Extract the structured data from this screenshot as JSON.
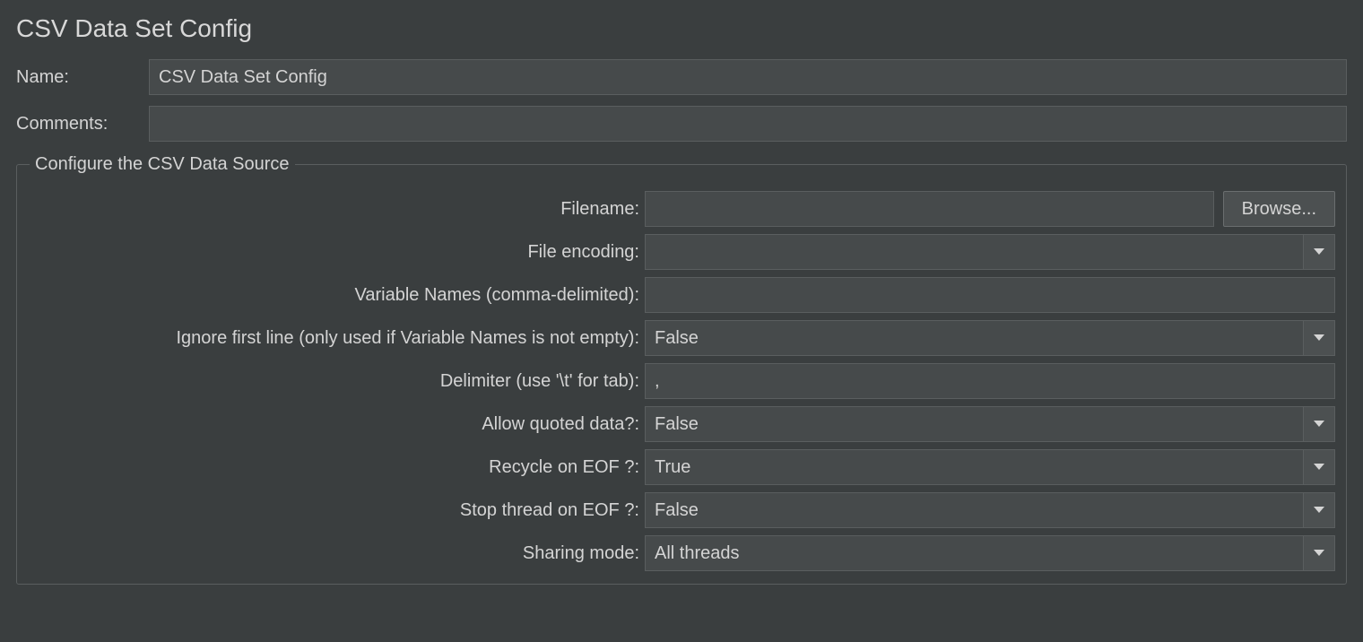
{
  "title": "CSV Data Set Config",
  "labels": {
    "name": "Name:",
    "comments": "Comments:"
  },
  "name_value": "CSV Data Set Config",
  "comments_value": "",
  "group": {
    "legend": "Configure the CSV Data Source",
    "filename": {
      "label": "Filename:",
      "value": "",
      "browse": "Browse..."
    },
    "file_encoding": {
      "label": "File encoding:",
      "value": ""
    },
    "variable_names": {
      "label": "Variable Names (comma-delimited):",
      "value": ""
    },
    "ignore_first_line": {
      "label": "Ignore first line (only used if Variable Names is not empty):",
      "value": "False"
    },
    "delimiter": {
      "label": "Delimiter (use '\\t' for tab):",
      "value": ","
    },
    "allow_quoted": {
      "label": "Allow quoted data?:",
      "value": "False"
    },
    "recycle_eof": {
      "label": "Recycle on EOF ?:",
      "value": "True"
    },
    "stop_thread_eof": {
      "label": "Stop thread on EOF ?:",
      "value": "False"
    },
    "sharing_mode": {
      "label": "Sharing mode:",
      "value": "All threads"
    }
  }
}
